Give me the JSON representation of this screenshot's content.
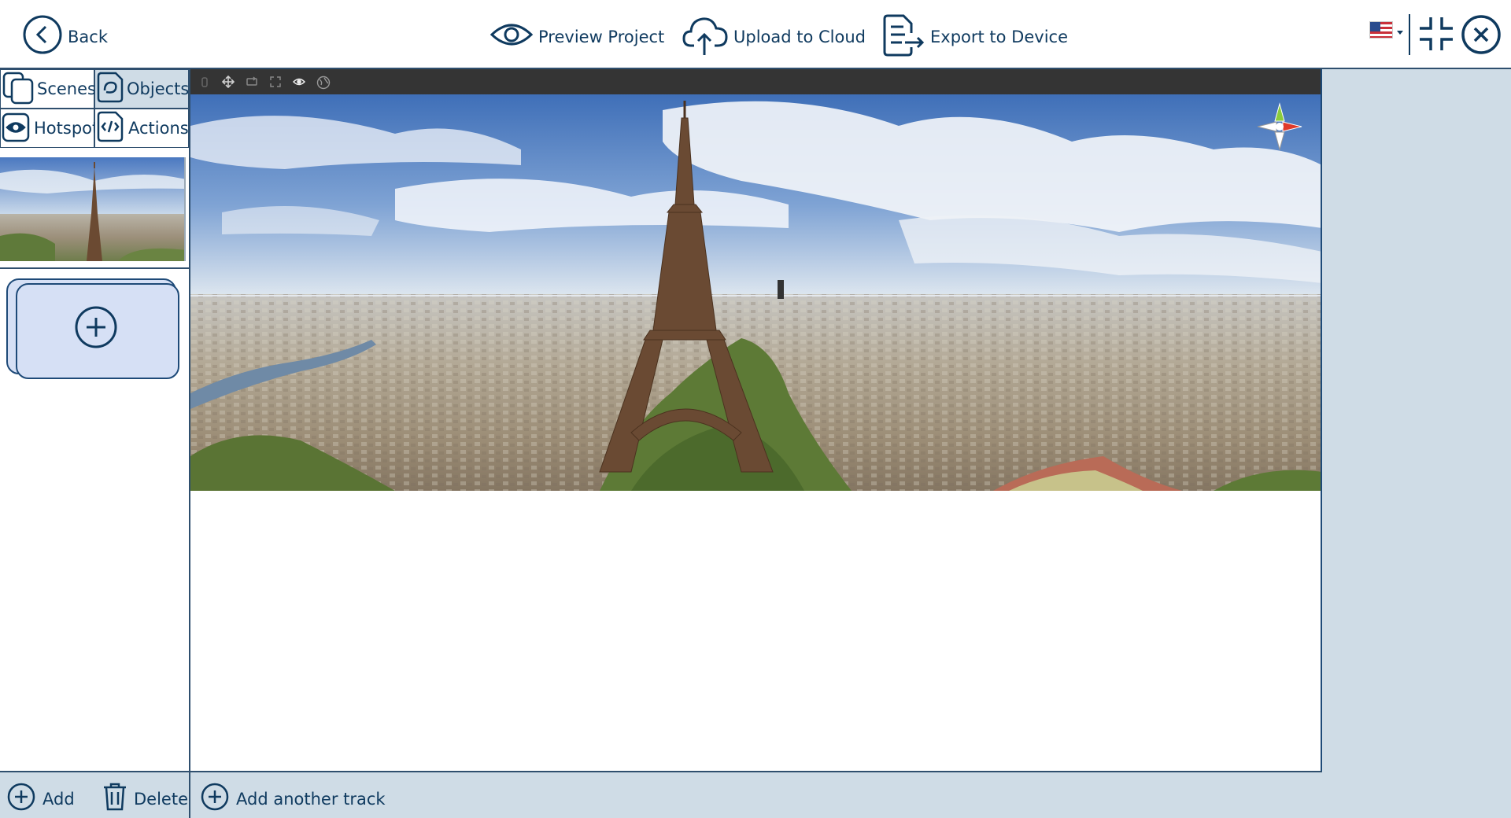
{
  "topbar": {
    "back_label": "Back",
    "preview_label": "Preview Project",
    "upload_label": "Upload to Cloud",
    "export_label": "Export to Device",
    "language_flag": "us-flag-icon"
  },
  "tabs": {
    "scenes": "Scenes",
    "objects": "Objects",
    "hotspot": "Hotspot",
    "actions": "Actions",
    "active": "objects"
  },
  "bottom": {
    "add_label": "Add",
    "delete_label": "Delete",
    "add_track_label": "Add another track"
  },
  "colors": {
    "accent": "#0f3a5f",
    "panel": "#cfdce6",
    "card": "#d6e0f5",
    "toolbar": "#343434"
  }
}
